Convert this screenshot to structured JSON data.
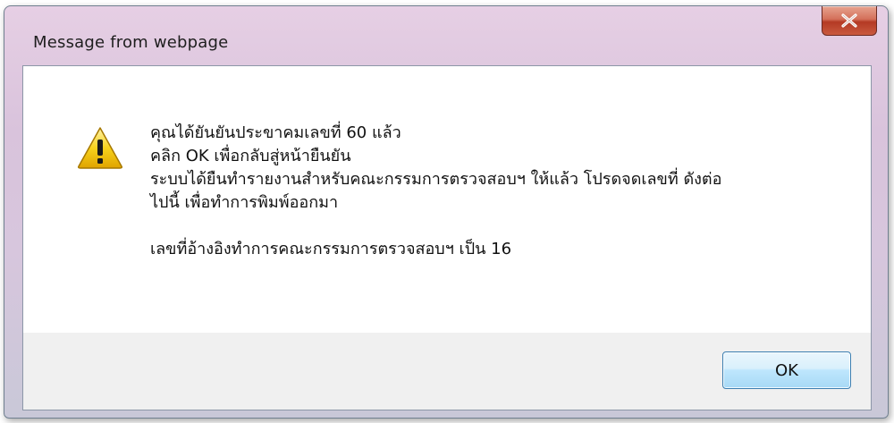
{
  "dialog": {
    "title": "Message from webpage",
    "icon": "warning-icon",
    "message_lines": [
      "คุณได้ยันยันประขาคมเลขที่ 60 แล้ว",
      "คลิก OK เพื่อกลับสู่หน้ายืนยัน",
      "ระบบได้ยืนทำรายงานสำหรับคณะกรรมการตรวจสอบฯ ให้แล้ว โปรดจดเลขที่ ดังต่อ",
      "ไปนี้ เพื่อทำการพิมพ์ออกมา",
      "",
      "เลขที่อ้างอิงทำการคณะกรรมการตรวจสอบฯ เป็น 16"
    ],
    "ok_label": "OK"
  },
  "colors": {
    "close_button": "#c9533a",
    "ok_border": "#3c7fb1",
    "footer_bg": "#f0f0f0"
  }
}
